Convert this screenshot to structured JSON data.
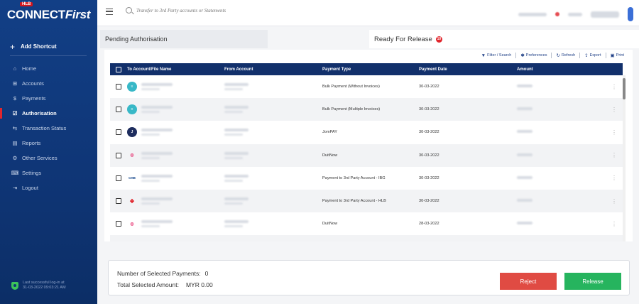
{
  "brand": {
    "hlb": "HLB",
    "name_connect": "CONNECT",
    "name_first": "First"
  },
  "sidebar": {
    "shortcut": "Add Shortcut",
    "items": [
      {
        "label": "Home",
        "icon": "home-icon",
        "glyph": "⌂"
      },
      {
        "label": "Accounts",
        "icon": "bank-icon",
        "glyph": "⊞"
      },
      {
        "label": "Payments",
        "icon": "dollar-icon",
        "glyph": "$"
      },
      {
        "label": "Authorisation",
        "icon": "check-square-icon",
        "glyph": "☑"
      },
      {
        "label": "Transaction Status",
        "icon": "transfer-icon",
        "glyph": "⇆"
      },
      {
        "label": "Reports",
        "icon": "document-icon",
        "glyph": "▤"
      },
      {
        "label": "Other Services",
        "icon": "services-icon",
        "glyph": "⚙"
      },
      {
        "label": "Settings",
        "icon": "settings-icon",
        "glyph": "⌨"
      },
      {
        "label": "Logout",
        "icon": "logout-icon",
        "glyph": "⇥"
      }
    ],
    "active_index": 3,
    "last_login_line1": "Last successful log-in at",
    "last_login_line2": "31-03-2022 09:03:21 AM"
  },
  "topbar": {
    "search_placeholder": "Transfer to 3rd Party accounts or Statements"
  },
  "tabs": {
    "pending": "Pending Authorisation",
    "ready": "Ready For Release",
    "ready_badge": "10"
  },
  "toolbar": {
    "filter": "Filter / Search",
    "preferences": "Preferences",
    "refresh": "Refresh",
    "export": "Export",
    "print": "Print"
  },
  "table": {
    "headers": [
      "To Account/File Name",
      "From Account",
      "Payment Type",
      "Payment Date",
      "Amount"
    ],
    "rows": [
      {
        "logo": "invoice",
        "payment_type": "Bulk Payment (Without Invoices)",
        "payment_date": "30-03-2022"
      },
      {
        "logo": "invoice",
        "payment_type": "Bulk Payment (Multiple Invoices)",
        "payment_date": "30-03-2022"
      },
      {
        "logo": "jompay",
        "payment_type": "JomPAY",
        "payment_date": "30-03-2022"
      },
      {
        "logo": "duitnow",
        "payment_type": "DuitNow",
        "payment_date": "30-03-2022"
      },
      {
        "logo": "chinese",
        "payment_type": "Payment to 3rd Party Account - IBG",
        "payment_date": "30-03-2022"
      },
      {
        "logo": "hlb",
        "payment_type": "Payment to 3rd Party Account - HLB",
        "payment_date": "30-03-2022"
      },
      {
        "logo": "duitnow",
        "payment_type": "DuitNow",
        "payment_date": "28-03-2022"
      },
      {
        "logo": "duitnow",
        "payment_type": "",
        "payment_date": ""
      }
    ]
  },
  "footer": {
    "selected_label": "Number of Selected Payments:",
    "selected_value": "0",
    "amount_label": "Total Selected Amount:",
    "amount_value": "MYR 0.00",
    "reject": "Reject",
    "release": "Release"
  },
  "colors": {
    "sidebar": "#0f3677",
    "header": "#12306b",
    "reject": "#e04b43",
    "release": "#26b45e",
    "accent_red": "#e1262d"
  }
}
